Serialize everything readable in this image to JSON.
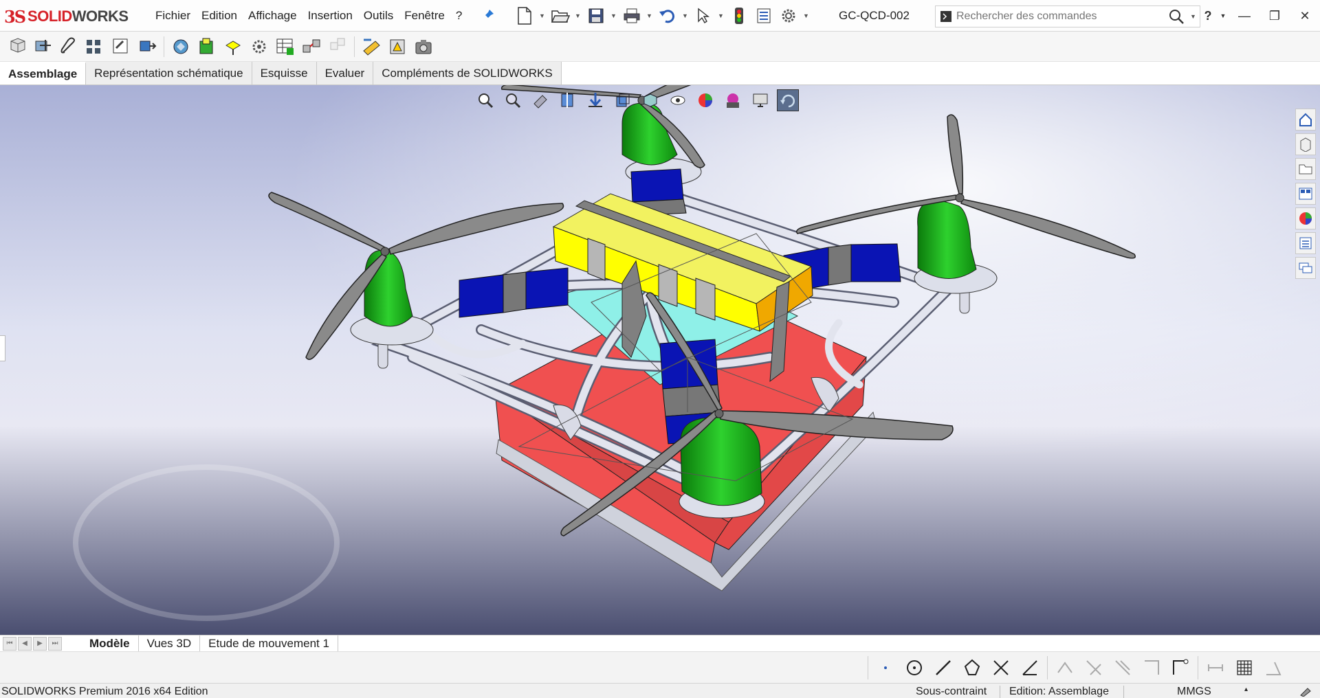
{
  "app": {
    "logo_ds": "3S",
    "logo_solid": "SOLID",
    "logo_works": "WORKS",
    "document_name": "GC-QCD-002"
  },
  "menu": [
    "Fichier",
    "Edition",
    "Affichage",
    "Insertion",
    "Outils",
    "Fenêtre",
    "?"
  ],
  "search": {
    "placeholder": "Rechercher des commandes"
  },
  "help_label": "?",
  "command_tabs": [
    {
      "label": "Assemblage",
      "active": true
    },
    {
      "label": "Représentation schématique",
      "active": false
    },
    {
      "label": "Esquisse",
      "active": false
    },
    {
      "label": "Evaluer",
      "active": false
    },
    {
      "label": "Compléments de SOLIDWORKS",
      "active": false
    }
  ],
  "bottom_tabs": [
    {
      "label": "Modèle",
      "active": true
    },
    {
      "label": "Vues 3D",
      "active": false
    },
    {
      "label": "Etude de mouvement 1",
      "active": false
    }
  ],
  "status": {
    "app_name": "SOLIDWORKS Premium 2016 x64 Edition",
    "constraint": "Sous-contraint",
    "mode": "Edition: Assemblage",
    "units": "MMGS"
  },
  "colors": {
    "motor": "#1fb81f",
    "battery": "#0a14b4",
    "payload": "#ffff00",
    "strap": "#808080",
    "box": "#f05050",
    "frame": "#d8dbe6",
    "propeller": "#8a8a8a",
    "accent": "#d62128"
  }
}
